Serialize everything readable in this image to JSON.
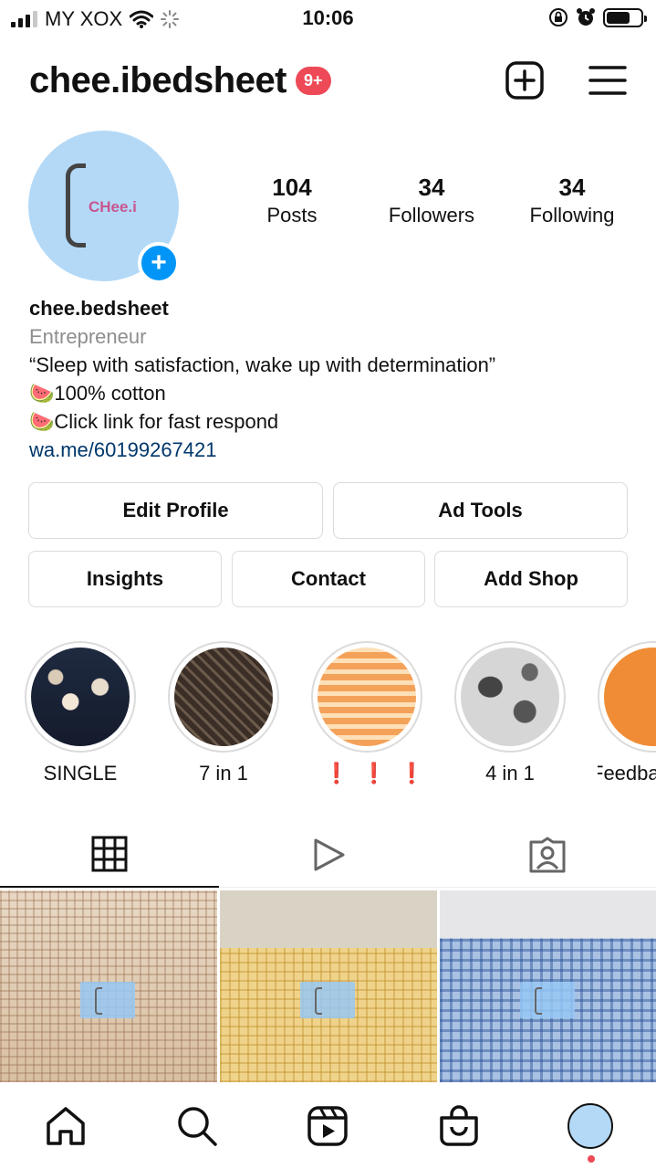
{
  "status_bar": {
    "carrier": "MY XOX",
    "time": "10:06"
  },
  "header": {
    "username": "chee.ibedsheet",
    "notification_count": "9+",
    "icons": [
      "new-post-icon",
      "menu-icon"
    ]
  },
  "profile": {
    "avatar_text": "CHee.i",
    "stats": [
      {
        "value": "104",
        "label": "Posts"
      },
      {
        "value": "34",
        "label": "Followers"
      },
      {
        "value": "34",
        "label": "Following"
      }
    ],
    "name": "chee.bedsheet",
    "category": "Entrepreneur",
    "bio_lines": [
      "“Sleep with satisfaction, wake up with determination”",
      "100% cotton",
      "Click link for fast respond"
    ],
    "bio_emoji": "🍉",
    "link": "wa.me/60199267421"
  },
  "buttons": {
    "edit_profile": "Edit Profile",
    "ad_tools": "Ad Tools",
    "insights": "Insights",
    "contact": "Contact",
    "add_shop": "Add Shop"
  },
  "highlights": [
    {
      "label": "SINGLE"
    },
    {
      "label": "7 in 1"
    },
    {
      "label": "❗❗❗"
    },
    {
      "label": "4 in 1"
    },
    {
      "label": "Feedba"
    }
  ],
  "tabs": [
    "grid-tab",
    "reels-tab",
    "tagged-tab"
  ],
  "bottom_nav": [
    "home-icon",
    "search-icon",
    "reels-icon",
    "shop-icon",
    "profile-avatar"
  ],
  "colors": {
    "accent_blue": "#0095f6",
    "badge_red": "#ed4956",
    "link_blue": "#00376b"
  }
}
